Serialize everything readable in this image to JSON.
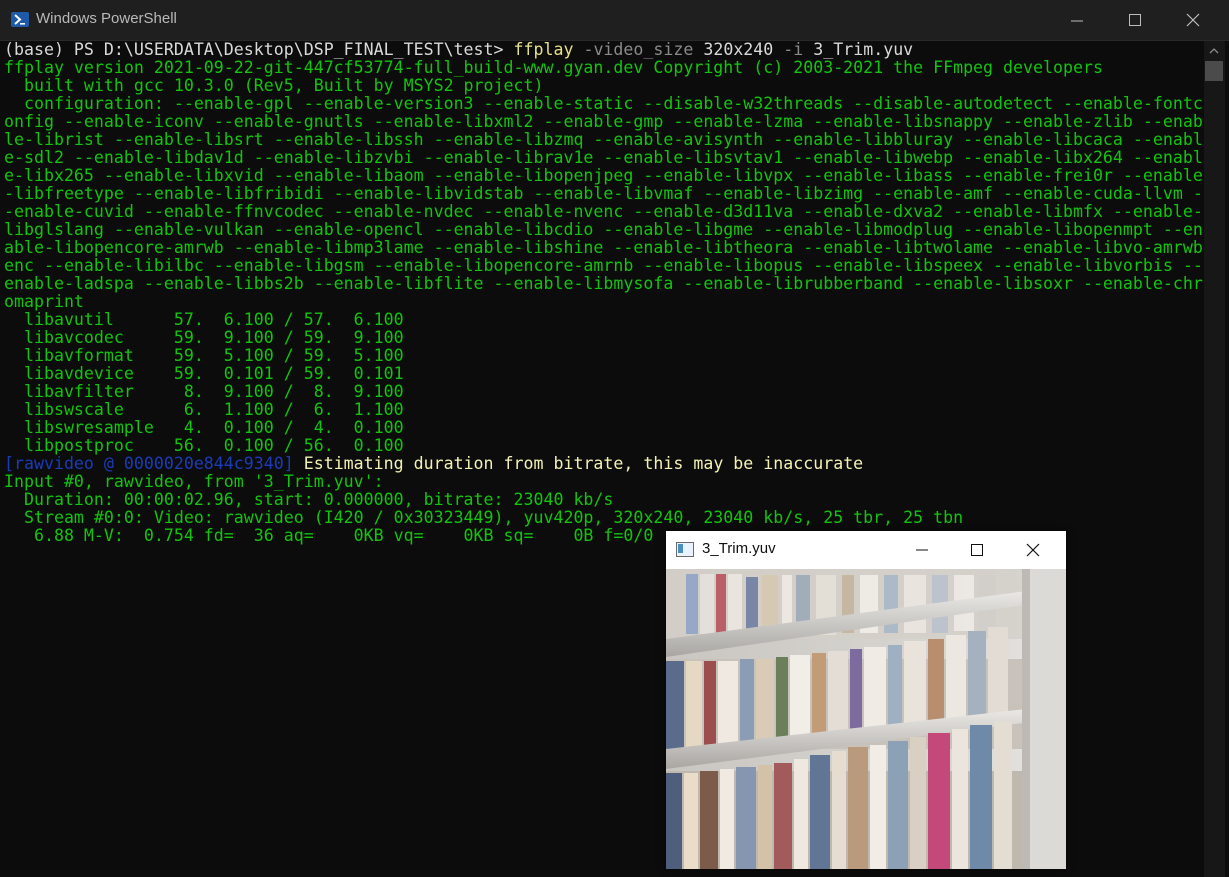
{
  "window": {
    "title": "Windows PowerShell",
    "icon": "powershell-icon"
  },
  "console": {
    "lines": [
      {
        "parts": [
          {
            "t": "(base) PS D:\\USERDATA\\Desktop\\DSP_FINAL_TEST\\test> ",
            "c": "c-white"
          },
          {
            "t": "ffplay ",
            "c": "c-yellow"
          },
          {
            "t": "-video_size ",
            "c": "c-gray"
          },
          {
            "t": "320x240 ",
            "c": "c-white"
          },
          {
            "t": "-i ",
            "c": "c-gray"
          },
          {
            "t": "3_Trim.yuv",
            "c": "c-white"
          }
        ]
      },
      {
        "parts": [
          {
            "t": "ffplay version 2021-09-22-git-447cf53774-full_build-www.gyan.dev Copyright (c) 2003-2021 the FFmpeg developers",
            "c": ""
          }
        ]
      },
      {
        "parts": [
          {
            "t": "  built with gcc 10.3.0 (Rev5, Built by MSYS2 project)",
            "c": ""
          }
        ]
      },
      {
        "parts": [
          {
            "t": "  configuration: --enable-gpl --enable-version3 --enable-static --disable-w32threads --disable-autodetect --enable-fontc",
            "c": ""
          }
        ]
      },
      {
        "parts": [
          {
            "t": "onfig --enable-iconv --enable-gnutls --enable-libxml2 --enable-gmp --enable-lzma --enable-libsnappy --enable-zlib --enab",
            "c": ""
          }
        ]
      },
      {
        "parts": [
          {
            "t": "le-librist --enable-libsrt --enable-libssh --enable-libzmq --enable-avisynth --enable-libbluray --enable-libcaca --enabl",
            "c": ""
          }
        ]
      },
      {
        "parts": [
          {
            "t": "e-sdl2 --enable-libdav1d --enable-libzvbi --enable-librav1e --enable-libsvtav1 --enable-libwebp --enable-libx264 --enabl",
            "c": ""
          }
        ]
      },
      {
        "parts": [
          {
            "t": "e-libx265 --enable-libxvid --enable-libaom --enable-libopenjpeg --enable-libvpx --enable-libass --enable-frei0r --enable",
            "c": ""
          }
        ]
      },
      {
        "parts": [
          {
            "t": "-libfreetype --enable-libfribidi --enable-libvidstab --enable-libvmaf --enable-libzimg --enable-amf --enable-cuda-llvm -",
            "c": ""
          }
        ]
      },
      {
        "parts": [
          {
            "t": "-enable-cuvid --enable-ffnvcodec --enable-nvdec --enable-nvenc --enable-d3d11va --enable-dxva2 --enable-libmfx --enable-",
            "c": ""
          }
        ]
      },
      {
        "parts": [
          {
            "t": "libglslang --enable-vulkan --enable-opencl --enable-libcdio --enable-libgme --enable-libmodplug --enable-libopenmpt --en",
            "c": ""
          }
        ]
      },
      {
        "parts": [
          {
            "t": "able-libopencore-amrwb --enable-libmp3lame --enable-libshine --enable-libtheora --enable-libtwolame --enable-libvo-amrwb",
            "c": ""
          }
        ]
      },
      {
        "parts": [
          {
            "t": "enc --enable-libilbc --enable-libgsm --enable-libopencore-amrnb --enable-libopus --enable-libspeex --enable-libvorbis --",
            "c": ""
          }
        ]
      },
      {
        "parts": [
          {
            "t": "enable-ladspa --enable-libbs2b --enable-libflite --enable-libmysofa --enable-librubberband --enable-libsoxr --enable-chr",
            "c": ""
          }
        ]
      },
      {
        "parts": [
          {
            "t": "omaprint",
            "c": ""
          }
        ]
      },
      {
        "parts": [
          {
            "t": "  libavutil      57.  6.100 / 57.  6.100",
            "c": ""
          }
        ]
      },
      {
        "parts": [
          {
            "t": "  libavcodec     59.  9.100 / 59.  9.100",
            "c": ""
          }
        ]
      },
      {
        "parts": [
          {
            "t": "  libavformat    59.  5.100 / 59.  5.100",
            "c": ""
          }
        ]
      },
      {
        "parts": [
          {
            "t": "  libavdevice    59.  0.101 / 59.  0.101",
            "c": ""
          }
        ]
      },
      {
        "parts": [
          {
            "t": "  libavfilter     8.  9.100 /  8.  9.100",
            "c": ""
          }
        ]
      },
      {
        "parts": [
          {
            "t": "  libswscale      6.  1.100 /  6.  1.100",
            "c": ""
          }
        ]
      },
      {
        "parts": [
          {
            "t": "  libswresample   4.  0.100 /  4.  0.100",
            "c": ""
          }
        ]
      },
      {
        "parts": [
          {
            "t": "  libpostproc    56.  0.100 / 56.  0.100",
            "c": ""
          }
        ]
      },
      {
        "parts": [
          {
            "t": "[rawvideo @ 0000020e844c9340] ",
            "c": "c-blue"
          },
          {
            "t": "Estimating duration from bitrate, this may be inaccurate",
            "c": "c-ylw-bright"
          }
        ]
      },
      {
        "parts": [
          {
            "t": "Input #0, rawvideo, from '3_Trim.yuv':",
            "c": ""
          }
        ]
      },
      {
        "parts": [
          {
            "t": "  Duration: 00:00:02.96, start: 0.000000, bitrate: 23040 kb/s",
            "c": ""
          }
        ]
      },
      {
        "parts": [
          {
            "t": "  Stream #0:0: Video: rawvideo (I420 / 0x30323449), yuv420p, 320x240, 23040 kb/s, 25 tbr, 25 tbn",
            "c": ""
          }
        ]
      },
      {
        "parts": [
          {
            "t": "   6.88 M-V:  0.754 fd=  36 aq=    0KB vq=    0KB sq=    0B f=0/0",
            "c": ""
          }
        ]
      }
    ]
  },
  "video_window": {
    "title": "3_Trim.yuv",
    "icon": "app-window-icon",
    "content": "video-frame-bookshelf"
  },
  "colors": {
    "console_bg": "#0c0c0c",
    "console_fg": "#13c40e",
    "titlebar_bg": "#1f1f1f"
  }
}
